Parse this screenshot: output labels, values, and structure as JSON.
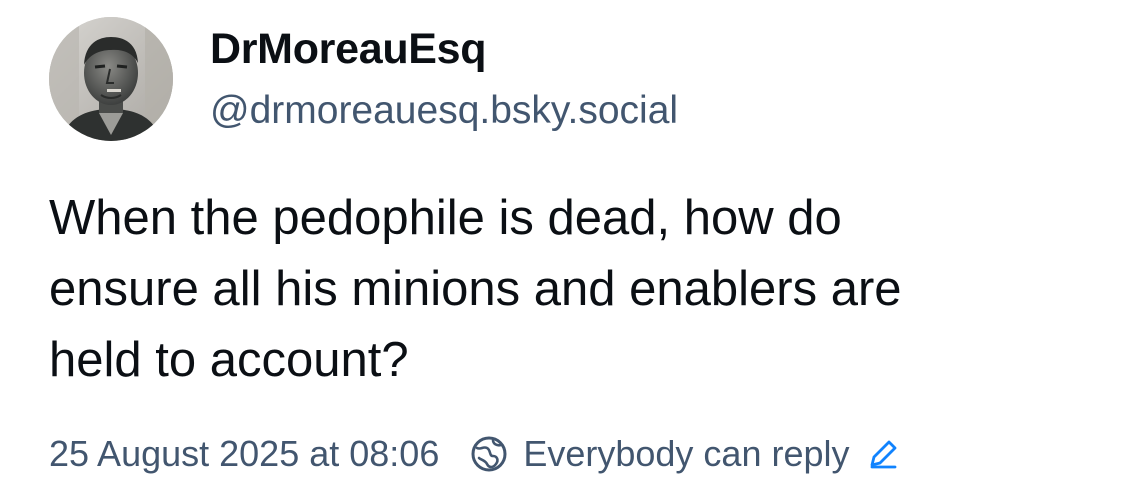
{
  "post": {
    "author": {
      "display_name": "DrMoreauEsq",
      "handle": "@drmoreauesq.bsky.social",
      "avatar_icon": "statue-portrait"
    },
    "text": "When the pedophile is dead, how do\nensure all his minions and enablers are\nheld to account?",
    "timestamp": "25 August 2025 at 08:06",
    "reply_setting": {
      "label": "Everybody can reply",
      "icon": "globe-icon",
      "edit_icon": "pencil-icon"
    }
  },
  "colors": {
    "text_primary": "#0b0f14",
    "text_secondary": "#42566f",
    "accent": "#1083fe"
  }
}
